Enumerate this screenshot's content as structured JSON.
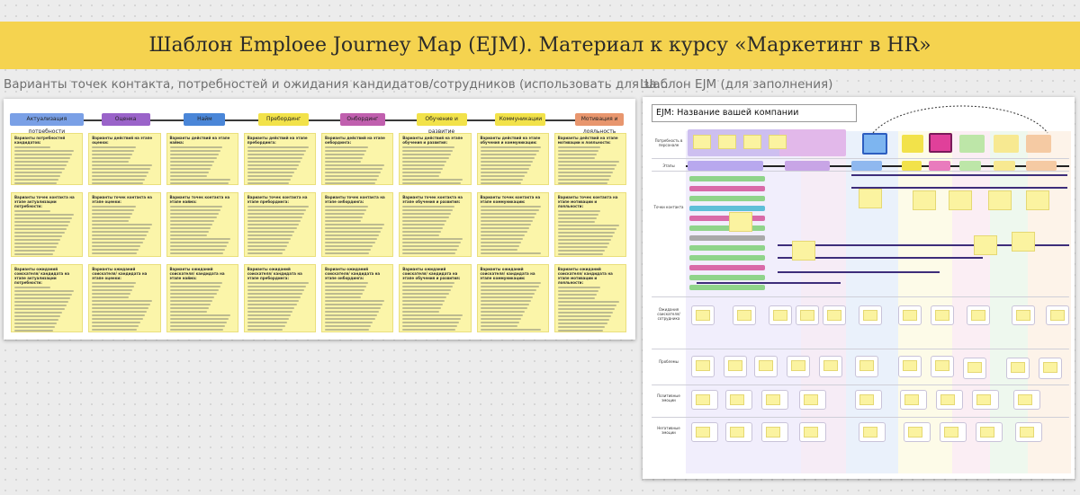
{
  "banner": {
    "title": "Шаблон Emploee Journey Map (EJM). Материал к курсу «Маркетинг в HR»"
  },
  "frames": {
    "left_label": "Варианты точек контакта, потребностей и ожидания кандидатов/сотрудников (использовать для за...",
    "right_label": "Шаблон EJM (для заполнения)"
  },
  "left_board": {
    "stages": [
      {
        "label": "Актуализация потребности",
        "color": "#7aa0e6"
      },
      {
        "label": "Оценка",
        "color": "#9a63c9"
      },
      {
        "label": "Найм",
        "color": "#4a86d8"
      },
      {
        "label": "Пребординг",
        "color": "#f2e24a"
      },
      {
        "label": "Онбординг",
        "color": "#c05fae"
      },
      {
        "label": "Обучение и развитие",
        "color": "#f2e24a"
      },
      {
        "label": "Коммуникации",
        "color": "#f2e24a"
      },
      {
        "label": "Мотивация и лояльность",
        "color": "#e8966e"
      }
    ],
    "rows": [
      [
        "Варианты потребностей кандидатов:",
        "Варианты действий на этапе оценки:",
        "Варианты действий на этапе найма:",
        "Варианты действий на этапе пребординга:",
        "Варианты действий на этапе онбординга:",
        "Варианты действий на этапе обучения и развития:",
        "Варианты действий на этапе обучения и коммуникации:",
        "Варианты действий на этапе мотивации и лояльности:"
      ],
      [
        "Варианты точек контакта на этапе актуализации потребности:",
        "Варианты точек контакта на этапе оценки:",
        "Варианты точек контакта на этапе найма:",
        "Варианты точек контакта на этапе пребординга:",
        "Варианты точек контакта на этапе онбординга:",
        "Варианты точек контакта на этапе обучения и развития:",
        "Варианты точек контакта на этапе коммуникации:",
        "Варианты точек контакта на этапе мотивации и лояльности:"
      ],
      [
        "Варианты ожиданий соискателя/ кандидата на этапе актуализации потребности:",
        "Варианты ожиданий соискателя/ кандидата на этапе оценки:",
        "Варианты ожиданий соискателя/ кандидата на этапе найма:",
        "Варианты ожиданий соискателя/ кандидата на этапе пребординга:",
        "Варианты ожиданий соискателя/ кандидата на этапе онбординга:",
        "Варианты ожиданий соискателя/ кандидата на этапе обучения и развития:",
        "Варианты ожиданий соискателя/ кандидата на этапе коммуникации:",
        "Варианты ожиданий соискателя/ кандидата на этапе мотивации и лояльности:"
      ]
    ]
  },
  "right_board": {
    "company_title": "EJM: Название вашей компании",
    "row_labels": [
      "Потребность в персонале",
      "Этапы",
      "Точки контакта",
      "Ожидания соискателя/ сотрудника",
      "Проблемы",
      "Позитивные эмоции",
      "Негативные эмоции"
    ],
    "stages": [
      "Актуализация потребности",
      "Оценка",
      "Найм"
    ]
  },
  "colors": {
    "banner": "#f5d34f",
    "sticky": "#fbf5a9",
    "accent_purple": "#3d2d7a",
    "accent_green": "#8fd48a"
  }
}
